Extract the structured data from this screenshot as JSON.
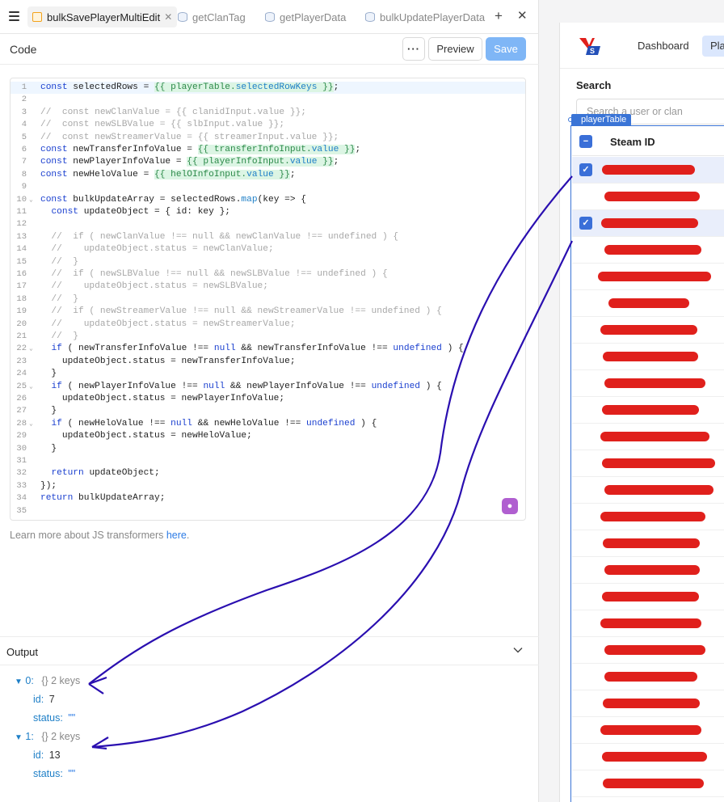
{
  "tabs": [
    {
      "label": "bulkSavePlayerMultiEdit",
      "icon": "query-icon",
      "active": true
    },
    {
      "label": "getClanTag",
      "icon": "database-icon",
      "active": false
    },
    {
      "label": "getPlayerData",
      "icon": "database-icon",
      "active": false
    },
    {
      "label": "bulkUpdatePlayerData",
      "icon": "database-icon",
      "active": false
    }
  ],
  "code_panel": {
    "title": "Code",
    "more_label": "···",
    "preview_label": "Preview",
    "save_label": "Save"
  },
  "code": {
    "lines": [
      {
        "n": "1",
        "fold": ""
      },
      {
        "n": "2",
        "fold": ""
      },
      {
        "n": "3",
        "fold": ""
      },
      {
        "n": "4",
        "fold": ""
      },
      {
        "n": "5",
        "fold": ""
      },
      {
        "n": "6",
        "fold": ""
      },
      {
        "n": "7",
        "fold": ""
      },
      {
        "n": "8",
        "fold": ""
      },
      {
        "n": "9",
        "fold": ""
      },
      {
        "n": "10",
        "fold": "v"
      },
      {
        "n": "11",
        "fold": ""
      },
      {
        "n": "12",
        "fold": ""
      },
      {
        "n": "13",
        "fold": ""
      },
      {
        "n": "14",
        "fold": ""
      },
      {
        "n": "15",
        "fold": ""
      },
      {
        "n": "16",
        "fold": ""
      },
      {
        "n": "17",
        "fold": ""
      },
      {
        "n": "18",
        "fold": ""
      },
      {
        "n": "19",
        "fold": ""
      },
      {
        "n": "20",
        "fold": ""
      },
      {
        "n": "21",
        "fold": ""
      },
      {
        "n": "22",
        "fold": "v"
      },
      {
        "n": "23",
        "fold": ""
      },
      {
        "n": "24",
        "fold": ""
      },
      {
        "n": "25",
        "fold": "v"
      },
      {
        "n": "26",
        "fold": ""
      },
      {
        "n": "27",
        "fold": ""
      },
      {
        "n": "28",
        "fold": "v"
      },
      {
        "n": "29",
        "fold": ""
      },
      {
        "n": "30",
        "fold": ""
      },
      {
        "n": "31",
        "fold": ""
      },
      {
        "n": "32",
        "fold": ""
      },
      {
        "n": "33",
        "fold": ""
      },
      {
        "n": "34",
        "fold": ""
      },
      {
        "n": "35",
        "fold": ""
      }
    ],
    "text": [
      "const selectedRows = {{ playerTable.selectedRowKeys }};",
      "",
      "//  const newClanValue = {{ clanidInput.value }};",
      "//  const newSLBValue = {{ slbInput.value }};",
      "//  const newStreamerValue = {{ streamerInput.value }};",
      "const newTransferInfoValue = {{ transferInfoInput.value }};",
      "const newPlayerInfoValue = {{ playerInfoInput.value }};",
      "const newHeloValue = {{ helOInfoInput.value }};",
      "",
      "const bulkUpdateArray = selectedRows.map(key => {",
      "  const updateObject = { id: key };",
      "",
      "  //  if ( newClanValue !== null && newClanValue !== undefined ) {",
      "  //    updateObject.status = newClanValue;",
      "  //  }",
      "  //  if ( newSLBValue !== null && newSLBValue !== undefined ) {",
      "  //    updateObject.status = newSLBValue;",
      "  //  }",
      "  //  if ( newStreamerValue !== null && newStreamerValue !== undefined ) {",
      "  //    updateObject.status = newStreamerValue;",
      "  //  }",
      "  if ( newTransferInfoValue !== null && newTransferInfoValue !== undefined ) {",
      "    updateObject.status = newTransferInfoValue;",
      "  }",
      "  if ( newPlayerInfoValue !== null && newPlayerInfoValue !== undefined ) {",
      "    updateObject.status = newPlayerInfoValue;",
      "  }",
      "  if ( newHeloValue !== null && newHeloValue !== undefined ) {",
      "    updateObject.status = newHeloValue;",
      "  }",
      "",
      "  return updateObject;",
      "});",
      "return bulkUpdateArray;",
      ""
    ]
  },
  "learn_more": {
    "text": "Learn more about JS transformers",
    "link": "here",
    "suffix": "."
  },
  "output": {
    "title": "Output",
    "items": [
      {
        "index": "0:",
        "meta": "{}  2 keys",
        "id_key": "id:",
        "id_val": "7",
        "status_key": "status:",
        "status_val": "\"\""
      },
      {
        "index": "1:",
        "meta": "{}  2 keys",
        "id_key": "id:",
        "id_val": "13",
        "status_key": "status:",
        "status_val": "\"\""
      }
    ]
  },
  "app": {
    "nav_dashboard": "Dashboard",
    "nav_players": "Pla",
    "search_label": "Search",
    "search_placeholder": "Search a user or clan",
    "widget_label": "playerTable",
    "column_header": "Steam ID",
    "rows_selected": [
      true,
      false,
      true,
      false,
      false,
      false,
      false,
      false,
      false,
      false,
      false,
      false,
      false,
      false,
      false,
      false,
      false,
      false,
      false,
      false,
      false,
      false,
      false,
      false
    ]
  },
  "colors": {
    "accent": "#3a6fd8",
    "save_button": "#7fb6f6",
    "annotation": "#2a0fb0",
    "redaction": "#e0201c"
  }
}
